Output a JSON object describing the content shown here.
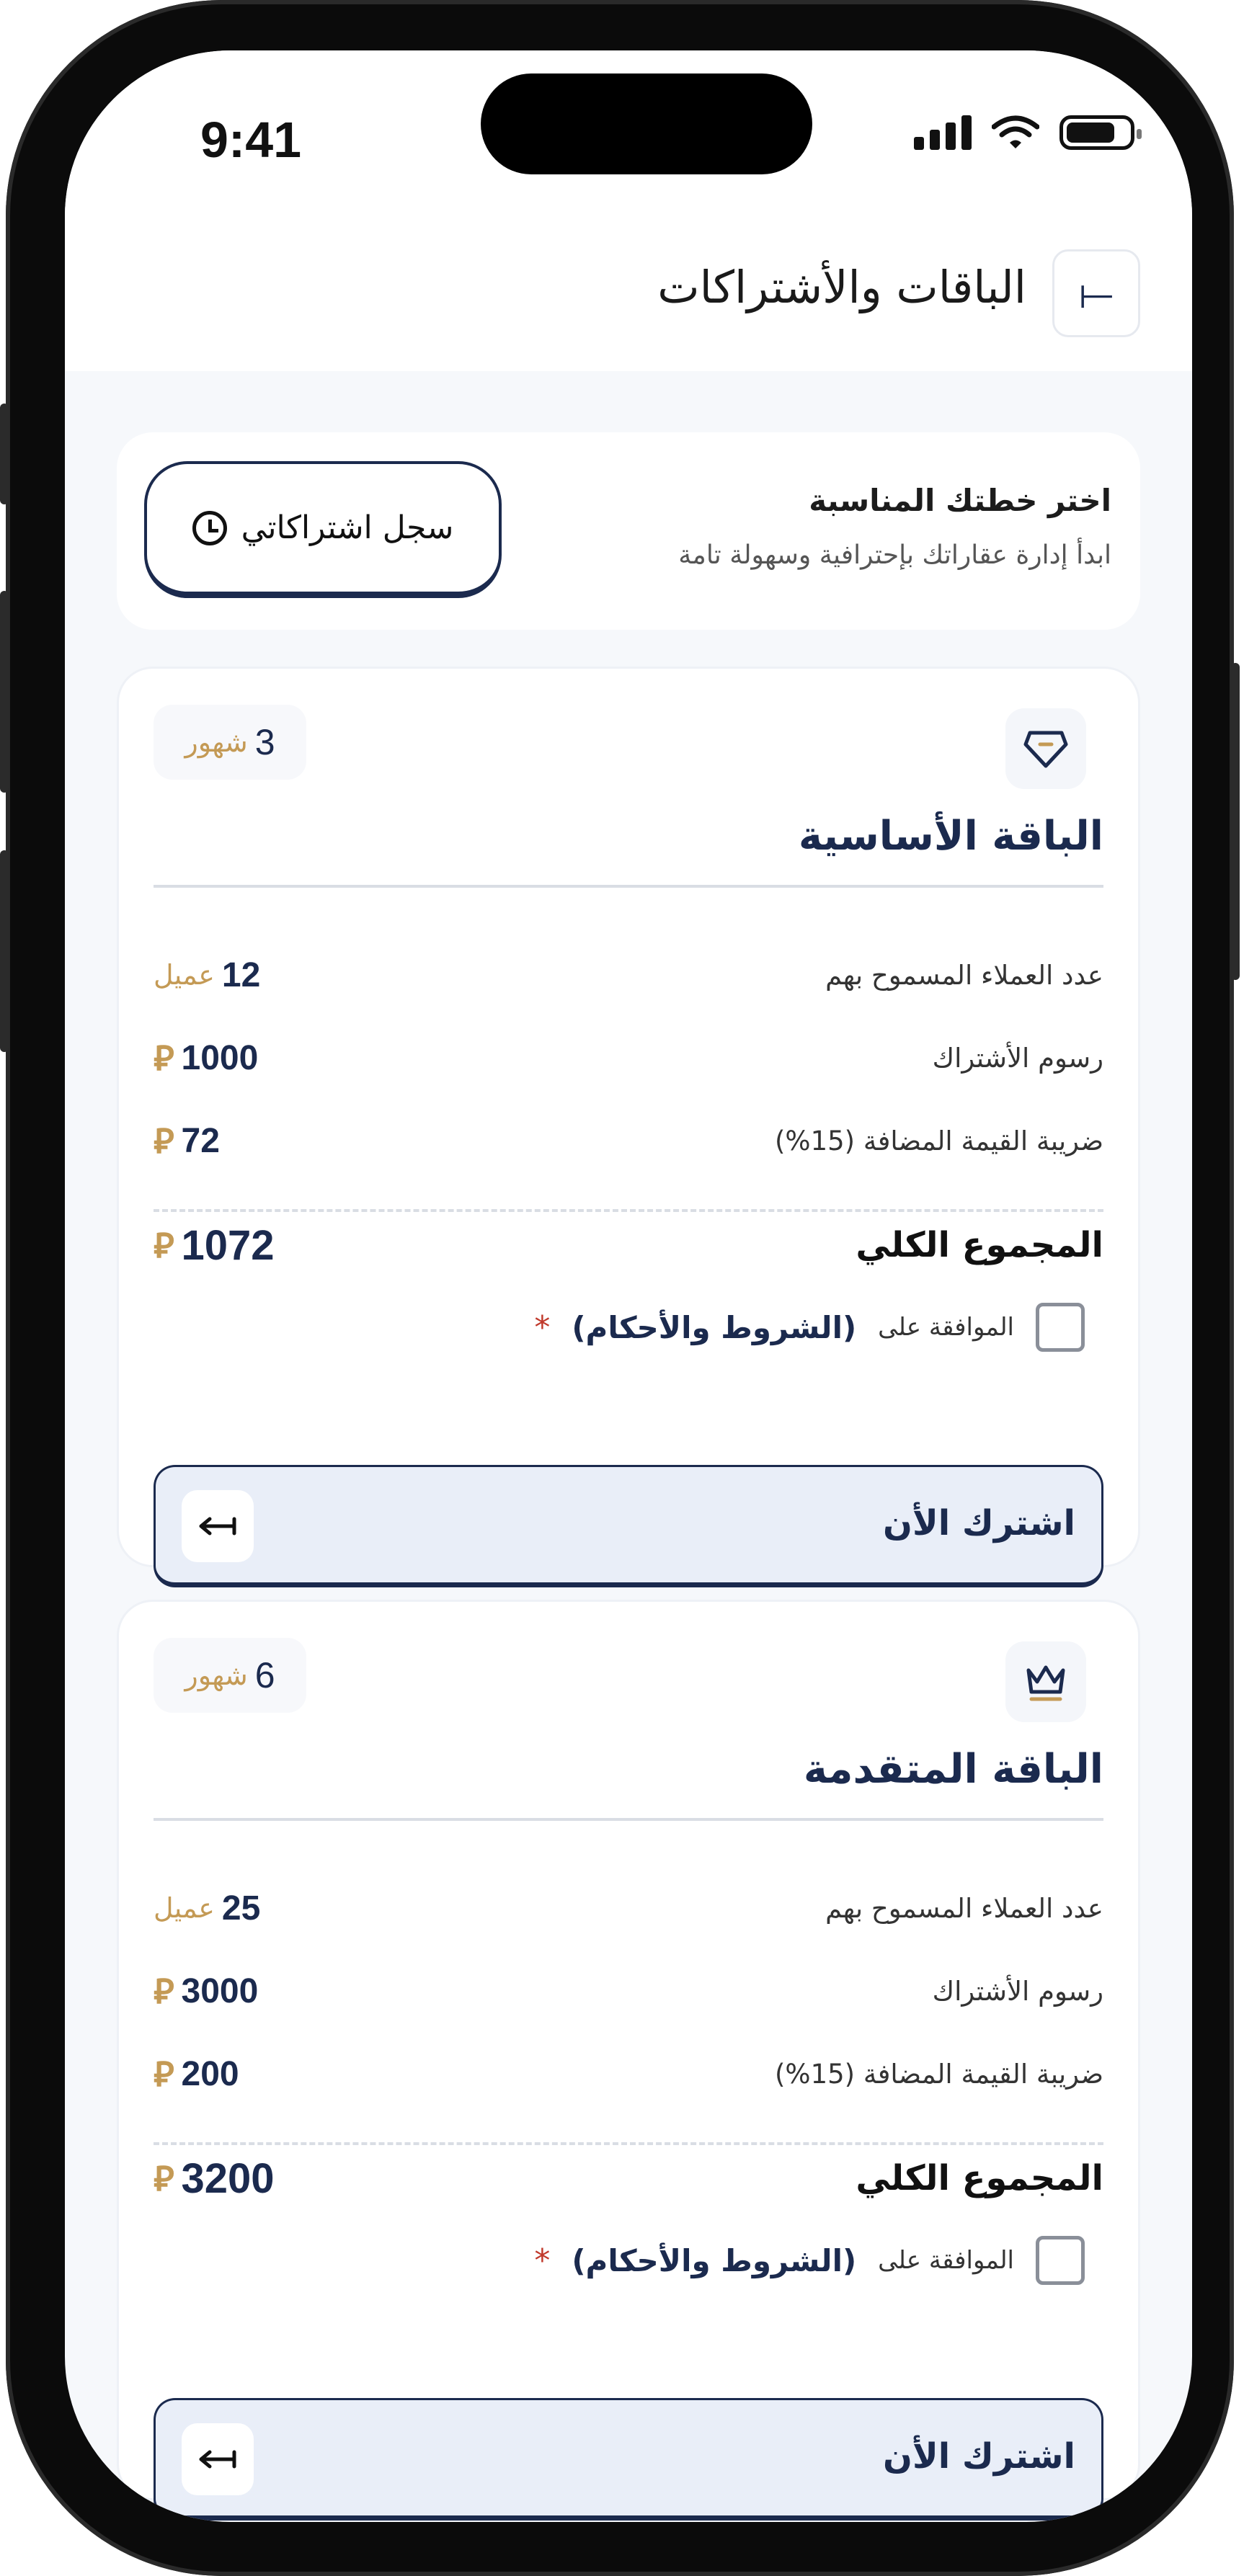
{
  "status_bar": {
    "time": "9:41"
  },
  "header": {
    "title": "الباقات والأشتراكات",
    "back_icon": "⟞"
  },
  "intro": {
    "title": "اختر خطتك المناسبة",
    "subtitle": "ابدأ إدارة عقاراتك بإحترافية وسهولة تامة",
    "history_button": "سجل اشتراكاتي"
  },
  "plans": [
    {
      "duration_num": "3",
      "duration_unit": "شهور",
      "name": "الباقة الأساسية",
      "clients_label": "عدد العملاء المسموح بهم",
      "clients_value": "12",
      "clients_unit": "عميل",
      "fee_label": "رسوم الأشتراك",
      "fee_value": "1000",
      "vat_label": "ضريبة القيمة المضافة (15%)",
      "vat_value": "72",
      "total_label": "المجموع الكلي",
      "total_value": "1072",
      "agree_text": "الموافقة على",
      "terms_text": "(الشروط والأحكام)",
      "required_mark": "*",
      "subscribe_label": "اشترك الأن"
    },
    {
      "duration_num": "6",
      "duration_unit": "شهور",
      "name": "الباقة المتقدمة",
      "clients_label": "عدد العملاء المسموح بهم",
      "clients_value": "25",
      "clients_unit": "عميل",
      "fee_label": "رسوم الأشتراك",
      "fee_value": "3000",
      "vat_label": "ضريبة القيمة المضافة (15%)",
      "vat_value": "200",
      "total_label": "المجموع الكلي",
      "total_value": "3200",
      "agree_text": "الموافقة على",
      "terms_text": "(الشروط والأحكام)",
      "required_mark": "*",
      "subscribe_label": "اشترك الأن"
    }
  ],
  "currency_symbol": "⃁",
  "colors": {
    "primary": "#1b2a4e",
    "accent": "#c49a55",
    "required": "#c0392b",
    "button_bg": "#e9eef8"
  }
}
